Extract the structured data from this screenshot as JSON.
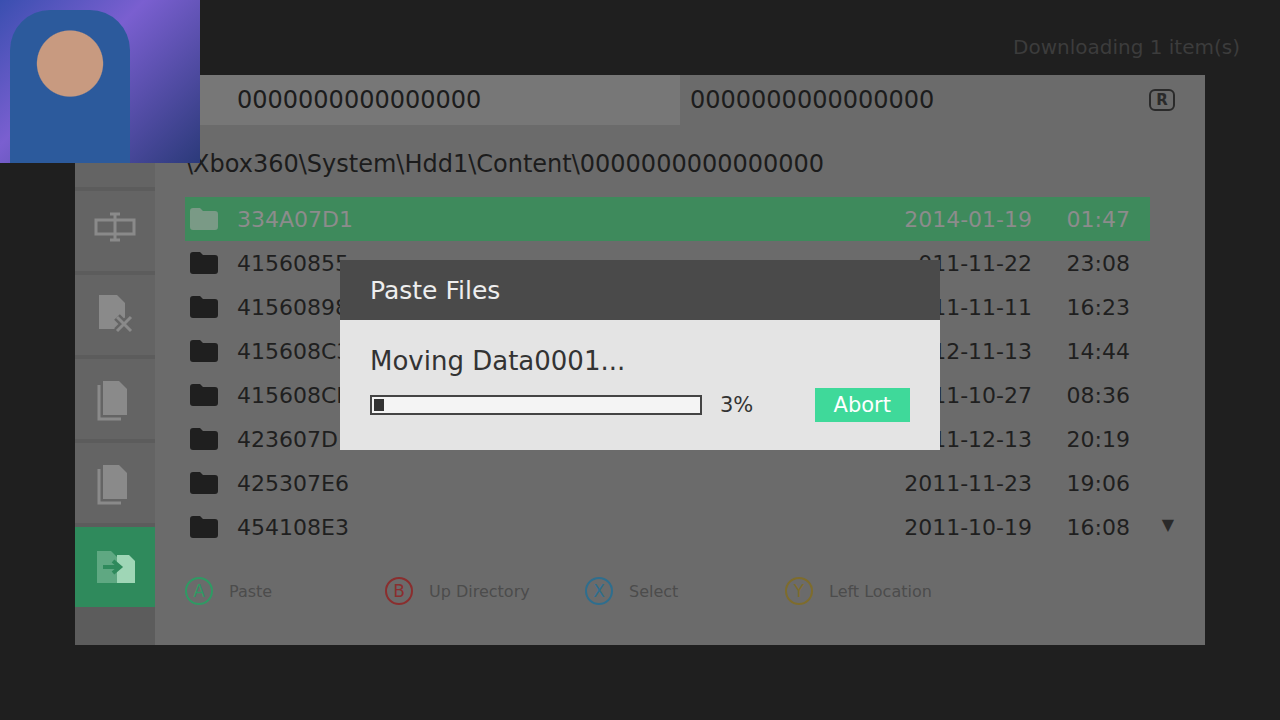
{
  "status": "Downloading 1 item(s)",
  "header": {
    "left": "0000000000000000",
    "right": "0000000000000000",
    "badge": "R"
  },
  "path": "\\Xbox360\\System\\Hdd1\\Content\\0000000000000000",
  "toolbar": [
    {
      "kind": "rename",
      "selected": false
    },
    {
      "kind": "delete",
      "selected": false
    },
    {
      "kind": "copy",
      "selected": false
    },
    {
      "kind": "paste",
      "selected": false
    },
    {
      "kind": "move",
      "selected": true
    }
  ],
  "rows": [
    {
      "name": "334A07D1",
      "date": "2014-01-19",
      "time": "01:47",
      "selected": true
    },
    {
      "name": "41560855",
      "date": "011-11-22",
      "time": "23:08",
      "selected": false
    },
    {
      "name": "41560898",
      "date": "011-11-11",
      "time": "16:23",
      "selected": false
    },
    {
      "name": "415608C3",
      "date": "012-11-13",
      "time": "14:44",
      "selected": false
    },
    {
      "name": "415608CE",
      "date": "011-10-27",
      "time": "08:36",
      "selected": false
    },
    {
      "name": "423607D1",
      "date": "011-12-13",
      "time": "20:19",
      "selected": false
    },
    {
      "name": "425307E6",
      "date": "2011-11-23",
      "time": "19:06",
      "selected": false
    },
    {
      "name": "454108E3",
      "date": "2011-10-19",
      "time": "16:08",
      "selected": false
    }
  ],
  "scroll_indicator": "▼",
  "legend": [
    {
      "key": "A",
      "label": "Paste",
      "color": "#2f9a64"
    },
    {
      "key": "B",
      "label": "Up Directory",
      "color": "#8a2e2e"
    },
    {
      "key": "X",
      "label": "Select",
      "color": "#2e6e8e"
    },
    {
      "key": "Y",
      "label": "Left Location",
      "color": "#7e6c2c"
    }
  ],
  "dialog": {
    "title": "Paste Files",
    "message": "Moving Data0001...",
    "level": 0.03,
    "reading": "3%",
    "button": "Abort"
  }
}
